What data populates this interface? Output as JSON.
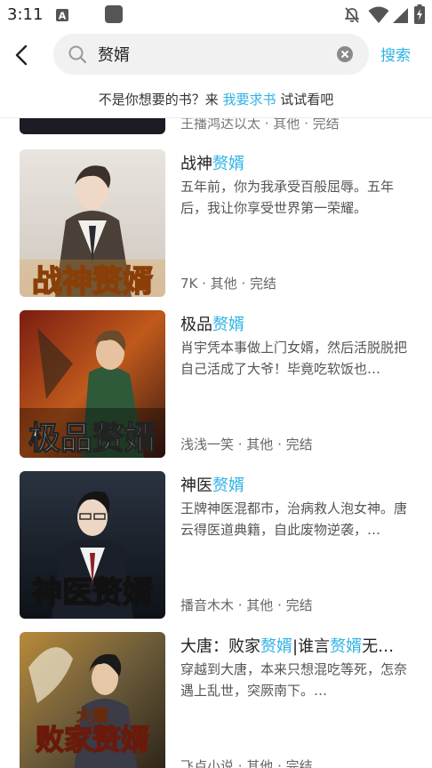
{
  "status_bar": {
    "time": "3:11",
    "icons": [
      "a-notification-icon",
      "app-notification-icon",
      "bell-off-icon",
      "wifi-icon",
      "signal-icon",
      "battery-charging-icon"
    ]
  },
  "search": {
    "value": "赘婿",
    "search_label": "搜索"
  },
  "request": {
    "prefix": "不是你想要的书？来",
    "link": "我要求书",
    "suffix": "试试看吧"
  },
  "partial_item": {
    "meta": "王播鸿达以太 · 其他 · 完结"
  },
  "books": [
    {
      "title_plain": "战神",
      "title_hl": "赘婿",
      "desc": "五年前，你为我承受百般屈辱。五年后，我让你享受世界第一荣耀。",
      "meta": "7K · 其他 · 完结",
      "cover_text": "战神赘婿"
    },
    {
      "title_plain": "极品",
      "title_hl": "赘婿",
      "desc": "肖宇凭本事做上门女婿，然后活脱脱把自己活成了大爷！毕竟吃软饭也…",
      "meta": "浅浅一笑 · 其他 · 完结",
      "cover_text": "极品赘婿"
    },
    {
      "title_plain": "神医",
      "title_hl": "赘婿",
      "desc": "王牌神医混都市，治病救人泡女神。唐云得医道典籍，自此废物逆袭，…",
      "meta": "播音木木 · 其他 · 完结",
      "cover_text": "神医赘婿"
    },
    {
      "title_p1": "大唐：败家",
      "title_h1": "赘婿",
      "title_p2": "|谁言",
      "title_h2": "赘婿",
      "title_p3": "无…",
      "desc": "穿越到大唐，本来只想混吃等死，怎奈遇上乱世，突厥南下。…",
      "meta": "飞卢小说 · 其他 · 完结",
      "cover_text_top": "大唐",
      "cover_text": "败家赘婿"
    }
  ],
  "colors": {
    "accent": "#2db3e6",
    "text": "#222222",
    "secondary": "#666666",
    "search_bg": "#f1f1f1"
  }
}
